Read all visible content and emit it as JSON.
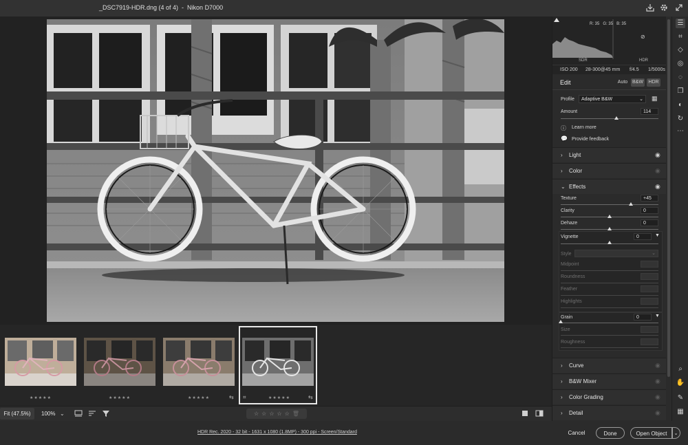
{
  "window": {
    "title": "_DSC7919-HDR.dng (4 of 4)  -  Nikon D7000"
  },
  "titlebar_icons": [
    "save-icon",
    "gear-icon",
    "fullscreen-icon"
  ],
  "histogram": {
    "r_label": "R: 35",
    "g_label": "G: 35",
    "b_label": "B: 35",
    "sdr_label": "SDR",
    "hdr_label": "HDR"
  },
  "exif": {
    "iso": "ISO 200",
    "lens": "28-300@45 mm",
    "aperture": "f/4.5",
    "shutter": "1/5000s"
  },
  "edit": {
    "title": "Edit",
    "modes": [
      "Auto",
      "B&W",
      "HDR"
    ],
    "profile_label": "Profile",
    "profile_value": "Adaptive B&W",
    "amount_label": "Amount",
    "amount_value": "114",
    "amount_fraction": 0.57,
    "learn_more": "Learn more",
    "feedback": "Provide feedback"
  },
  "sections": {
    "light": "Light",
    "color": "Color",
    "effects": "Effects",
    "curve": "Curve",
    "bw_mixer": "B&W Mixer",
    "color_grading": "Color Grading",
    "detail": "Detail"
  },
  "effects": {
    "texture_label": "Texture",
    "texture_value": "+45",
    "texture_fraction": 0.72,
    "clarity_label": "Clarity",
    "clarity_value": "0",
    "dehaze_label": "Dehaze",
    "dehaze_value": "0",
    "vignette_label": "Vignette",
    "vignette_value": "0",
    "style_label": "Style",
    "midpoint_label": "Midpoint",
    "roundness_label": "Roundness",
    "feather_label": "Feather",
    "highlights_label": "Highlights",
    "grain_label": "Grain",
    "grain_value": "0",
    "size_label": "Size",
    "roughness_label": "Roughness"
  },
  "filmstrip": {
    "stars": "★★★★★",
    "thumbs": [
      {
        "tone": "color-bright"
      },
      {
        "tone": "color-dark"
      },
      {
        "tone": "color-mid"
      },
      {
        "tone": "bw"
      }
    ]
  },
  "bottombar": {
    "fit_label": "Fit (47.5%)",
    "zoom_label": "100%",
    "rating": "☆☆☆☆☆"
  },
  "footer": {
    "info": "HDR Rec. 2020 - 32 bit - 1631 x 1080 (1.8MP) - 300 ppi - Screen/Standard",
    "cancel": "Cancel",
    "done": "Done",
    "open_object": "Open Object"
  },
  "colors": {
    "panel_bg": "#2b2b2b",
    "canvas_bg": "#222222",
    "accent_selected": "#e8e8e8"
  }
}
